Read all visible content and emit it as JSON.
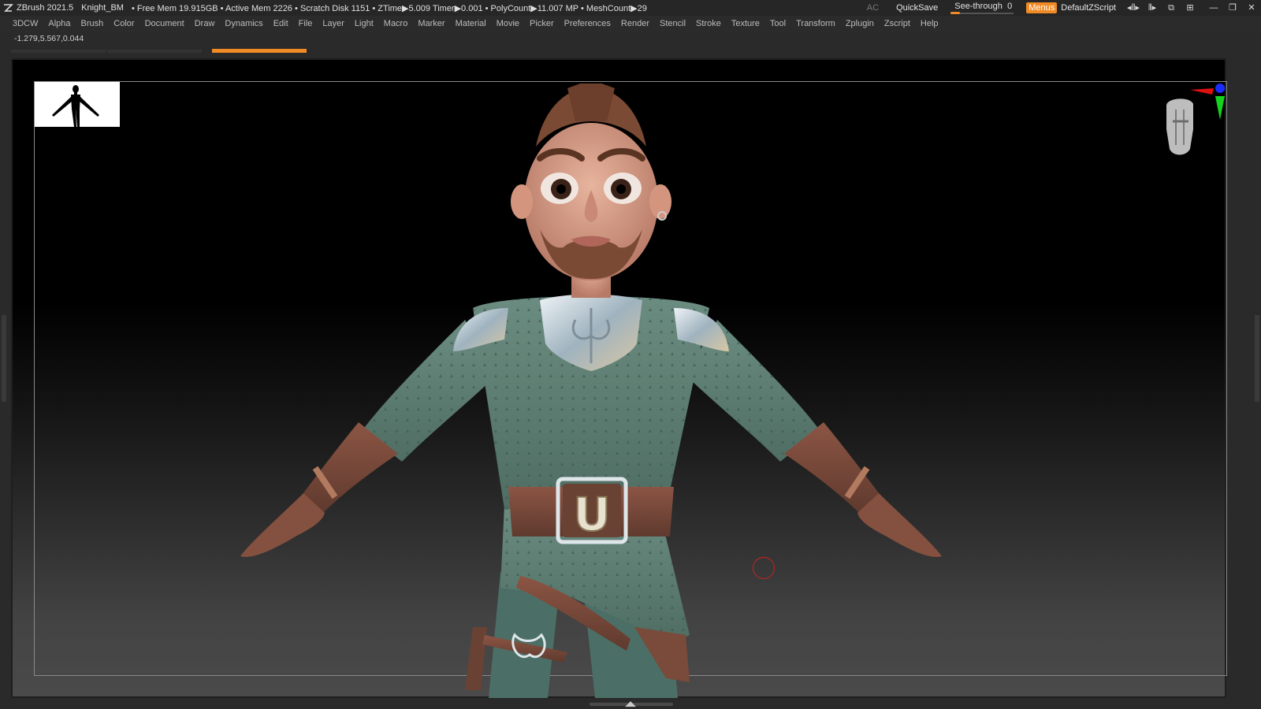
{
  "titlebar": {
    "app": "ZBrush 2021.5",
    "document": "Knight_BM",
    "stats": "• Free Mem 19.915GB • Active Mem 2226 • Scratch Disk 1151 • ZTime▶5.009 Timer▶0.001 • PolyCount▶11.007 MP • MeshCount▶29",
    "ac": "AC",
    "quicksave": "QuickSave",
    "seethrough_label": "See-through",
    "seethrough_value": "0",
    "menus": "Menus",
    "script": "DefaultZScript"
  },
  "menubar": [
    "3DCW",
    "Alpha",
    "Brush",
    "Color",
    "Document",
    "Draw",
    "Dynamics",
    "Edit",
    "File",
    "Layer",
    "Light",
    "Macro",
    "Marker",
    "Material",
    "Movie",
    "Picker",
    "Preferences",
    "Render",
    "Stencil",
    "Stroke",
    "Texture",
    "Tool",
    "Transform",
    "Zplugin",
    "Zscript",
    "Help"
  ],
  "coords": "-1.279,5.567,0.044",
  "colors": {
    "accent": "#f08a24",
    "skin": "#d9a08a",
    "shirt": "#5e7f74",
    "leather": "#7a4a3a",
    "metal": "#c9d4da",
    "hair": "#7a4a34"
  },
  "icons": [
    "zbrush-logo-icon",
    "interface-scale-icon",
    "toggle-icon",
    "restore-icon",
    "layout-icon",
    "minimize-icon",
    "maximize-icon",
    "close-icon"
  ],
  "belt_letter": "U"
}
